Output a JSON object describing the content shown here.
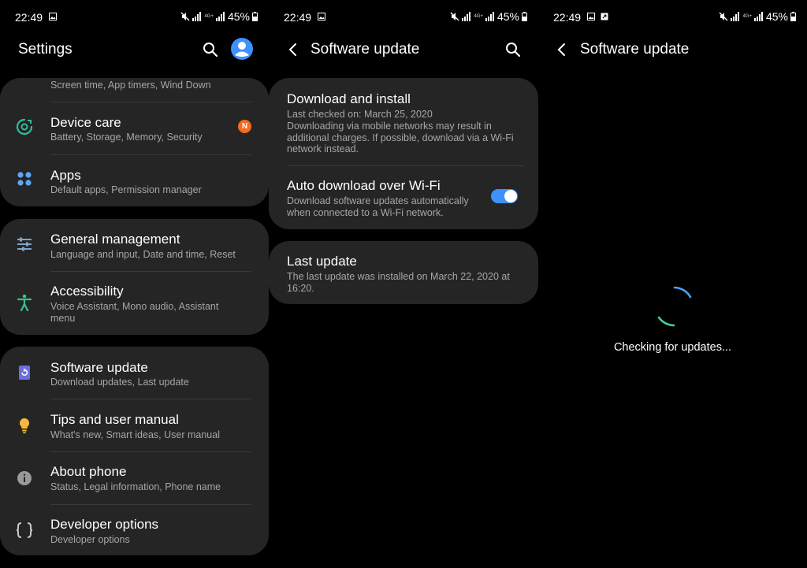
{
  "status_bar": {
    "time": "22:49",
    "network": "4G+",
    "battery": "45%"
  },
  "colors": {
    "accent_blue": "#3e91ff",
    "badge_orange": "#f36c21",
    "card_bg": "#252525",
    "spinner_blue": "#4aa3f5",
    "spinner_green": "#3dd6a0"
  },
  "settings_screen": {
    "title": "Settings",
    "icons": [
      "search-icon",
      "account-icon"
    ],
    "groups": [
      {
        "items": [
          {
            "icon": "digital-wellbeing-icon",
            "title": "",
            "subtitle": "Screen time, App timers, Wind Down"
          },
          {
            "icon": "device-care-icon",
            "title": "Device care",
            "subtitle": "Battery, Storage, Memory, Security",
            "badge": "N"
          },
          {
            "icon": "apps-icon",
            "title": "Apps",
            "subtitle": "Default apps, Permission manager"
          }
        ]
      },
      {
        "items": [
          {
            "icon": "general-management-icon",
            "title": "General management",
            "subtitle": "Language and input, Date and time, Reset"
          },
          {
            "icon": "accessibility-icon",
            "title": "Accessibility",
            "subtitle": "Voice Assistant, Mono audio, Assistant menu"
          }
        ]
      },
      {
        "items": [
          {
            "icon": "software-update-icon",
            "title": "Software update",
            "subtitle": "Download updates, Last update"
          },
          {
            "icon": "tips-icon",
            "title": "Tips and user manual",
            "subtitle": "What's new, Smart ideas, User manual"
          },
          {
            "icon": "info-icon",
            "title": "About phone",
            "subtitle": "Status, Legal information, Phone name"
          },
          {
            "icon": "developer-options-icon",
            "title": "Developer options",
            "subtitle": "Developer options"
          }
        ]
      }
    ]
  },
  "software_update_screen": {
    "title": "Software update",
    "download_install": {
      "title": "Download and install",
      "last_checked": "Last checked on: March 25, 2020",
      "note": "Downloading via mobile networks may result in additional charges. If possible, download via a Wi-Fi network instead."
    },
    "auto_download": {
      "title": "Auto download over Wi-Fi",
      "description": "Download software updates automatically when connected to a Wi-Fi network.",
      "enabled": true
    },
    "last_update": {
      "title": "Last update",
      "description": "The last update was installed on March 22, 2020 at 16:20."
    }
  },
  "checking_screen": {
    "title": "Software update",
    "message": "Checking for updates..."
  }
}
